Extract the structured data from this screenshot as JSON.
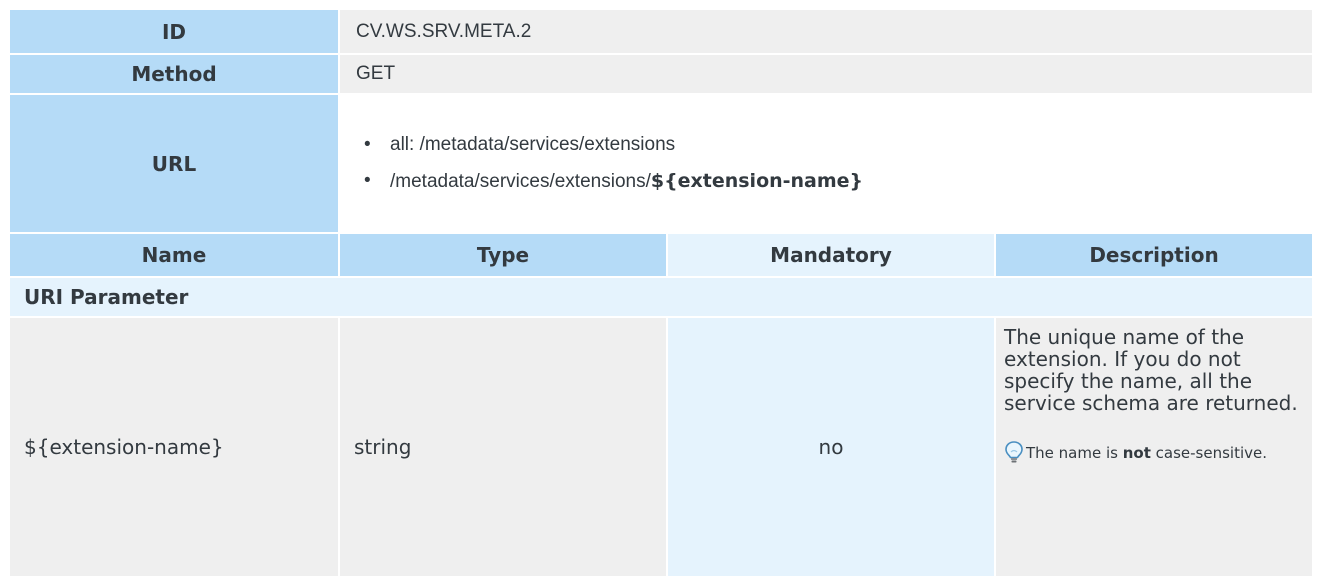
{
  "rows": {
    "id": {
      "label": "ID",
      "value": "CV.WS.SRV.META.2"
    },
    "method": {
      "label": "Method",
      "value": "GET"
    },
    "url": {
      "label": "URL",
      "item1": "all: /metadata/services/extensions",
      "item2_prefix": "/metadata/services/extensions/",
      "item2_param": "${extension-name}"
    }
  },
  "columns": {
    "name": "Name",
    "type": "Type",
    "mandatory": "Mandatory",
    "description": "Description"
  },
  "section": "URI Parameter",
  "param": {
    "name": "${extension-name}",
    "type": "string",
    "mandatory": "no",
    "description": "The unique name of the extension. If you do not specify the name, all the service schema are returned.",
    "note_prefix": "The name is ",
    "note_bold": "not",
    "note_suffix": " case-sensitive.",
    "note_icon": "lightbulb-icon"
  },
  "colors": {
    "header_blue": "#b5dbf7",
    "light_blue": "#e5f3fd",
    "grey": "#efefef",
    "text": "#333a40"
  }
}
